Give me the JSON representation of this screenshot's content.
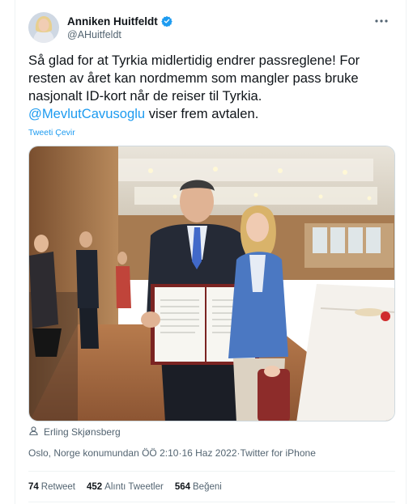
{
  "author": {
    "display_name": "Anniken Huitfeldt",
    "handle": "@AHuitfeldt",
    "verified": true
  },
  "icons": {
    "verified": "verified-badge-icon",
    "more": "more-options-icon",
    "person": "person-icon"
  },
  "tweet": {
    "text_main": "Så glad for at Tyrkia midlertidig endrer passreglene! For resten av året kan nordmemm som mangler pass bruke nasjonalt ID-kort når de reiser til Tyrkia.",
    "mention": "@MevlutCavusoglu",
    "text_after": " viser frem avtalen.",
    "translate_label": "Tweeti Çevir"
  },
  "photo_credit": "Erling Skjønsberg",
  "meta": {
    "location_time": "Oslo, Norge konumundan ÖÖ 2:10",
    "separator": " · ",
    "date": "16 Haz 2022",
    "app": "Twitter for iPhone"
  },
  "stats": {
    "retweets_count": "74",
    "retweets_label": "Retweet",
    "quotes_count": "452",
    "quotes_label": "Alıntı Tweetler",
    "likes_count": "564",
    "likes_label": "Beğeni"
  },
  "colors": {
    "accent": "#1d9bf0",
    "secondary_text": "#536471",
    "primary_text": "#0f1419"
  }
}
